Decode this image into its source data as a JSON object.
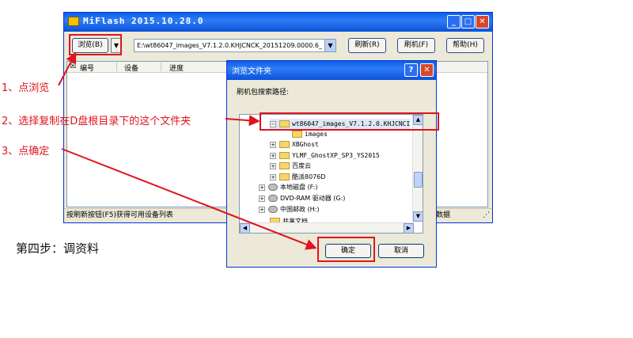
{
  "main_window": {
    "title": "MiFlash 2015.10.28.0",
    "browse_label": "浏览(B)",
    "browse_dropdown": "▼",
    "path_value": "E:\\wt86047_images_V7.1.2.0.KHJCNCK_20151209.0000.6_",
    "refresh_label": "刷新(R)",
    "flash_label": "刷机(F)",
    "help_label": "帮助(H)",
    "columns": [
      "编号",
      "设备",
      "进度"
    ],
    "partial_column": "数据",
    "status_text": "按刷新按钮(F5)获得可用设备列表"
  },
  "dialog": {
    "title": "浏览文件夹",
    "help_btn": "?",
    "close_btn": "✕",
    "label": "刷机包搜索路径:",
    "tree": [
      {
        "text": "wt86047_images_V7.1.2.0.KHJCNCI",
        "expander": "⊟",
        "icon": "folder-open-icon"
      },
      {
        "text": "images",
        "expander": "",
        "icon": "folder-icon"
      },
      {
        "text": "XBGhost",
        "expander": "⊞",
        "icon": "folder-icon"
      },
      {
        "text": "YLMF_GhostXP_SP3_YS2015",
        "expander": "⊞",
        "icon": "folder-icon"
      },
      {
        "text": "百度云",
        "expander": "⊞",
        "icon": "folder-icon"
      },
      {
        "text": "酷派8076D",
        "expander": "⊞",
        "icon": "folder-icon"
      },
      {
        "text": "本地磁盘 (F:)",
        "expander": "⊞",
        "icon": "drive-icon"
      },
      {
        "text": "DVD-RAM 驱动器 (G:)",
        "expander": "⊞",
        "icon": "dvd-drive-icon"
      },
      {
        "text": "中国邮政 (H:)",
        "expander": "⊞",
        "icon": "drive-icon"
      },
      {
        "text": "共享文档",
        "expander": "⊞",
        "icon": "folder-icon"
      }
    ],
    "ok_label": "确定",
    "cancel_label": "取消"
  },
  "annotations": {
    "step1": "1、点浏览",
    "step2": "2、选择复制在D盘根目录下的这个文件夹",
    "step3": "3、点确定",
    "step4": "第四步：调资料"
  },
  "colors": {
    "annotation_red": "#e0141e",
    "titlebar_blue": "#0a5fe8",
    "window_face": "#ece9d8"
  }
}
